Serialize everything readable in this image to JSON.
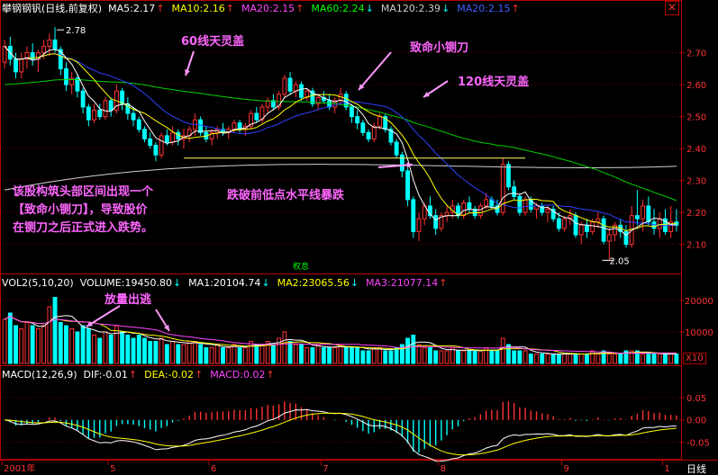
{
  "header": {
    "title": "攀钢钢钒(日线,前复权)",
    "ma": [
      {
        "label": "MA5:2.17",
        "color": "#ffffff",
        "arrow": "↑"
      },
      {
        "label": "MA10:2.16",
        "color": "#ffff00",
        "arrow": "↑"
      },
      {
        "label": "MA20:2.15",
        "color": "#ff44ff",
        "arrow": "↑"
      },
      {
        "label": "MA60:2.24",
        "color": "#00ff00",
        "arrow": "↓"
      },
      {
        "label": "MA120:2.39",
        "color": "#cccccc",
        "arrow": "↓"
      },
      {
        "label": "MA20:2.15",
        "color": "#4060ff",
        "arrow": "↑"
      }
    ],
    "close_box": "×"
  },
  "colors": {
    "up": "#ff3232",
    "down": "#00ffff",
    "ma5": "#ffffff",
    "ma10": "#ffff00",
    "ma20": "#3040ff",
    "ma60": "#00d000",
    "ma120": "#d0d0d0",
    "axis": "#b40000",
    "annotation": "#ff66ff",
    "arrow": "#ff99ff",
    "support": "#ffff60"
  },
  "annotations": {
    "a60": "60线天灵盖",
    "knife": "致命小铡刀",
    "a120": "120线天灵盖",
    "break": "跌破前低点水平线暴跌",
    "note_lines": [
      "该股构筑头部区间出现一个",
      "【致命小铡刀】，导致股价",
      "在铡刀之后正式进入跌势。"
    ],
    "volume": "放量出逃",
    "high": "2.78",
    "low": "2.05",
    "rights": "权息"
  },
  "volume_header": {
    "label": "VOL2(5,10,20)",
    "items": [
      {
        "label": "VOLUME:19450.80",
        "color": "#ffffff",
        "arrow": "↓"
      },
      {
        "label": "MA1:20104.74",
        "color": "#ffffff",
        "arrow": "↓"
      },
      {
        "label": "MA2:23065.56",
        "color": "#ffff00",
        "arrow": "↓"
      },
      {
        "label": "MA3:21077.14",
        "color": "#ff44ff",
        "arrow": "↑"
      }
    ],
    "unit": "X10"
  },
  "macd_header": {
    "label": "MACD(12,26,9)",
    "items": [
      {
        "label": "DIF:-0.01",
        "color": "#ffffff",
        "arrow": "↑"
      },
      {
        "label": "DEA:-0.02",
        "color": "#ffff00",
        "arrow": "↑"
      },
      {
        "label": "MACD:0.02",
        "color": "#ff44ff",
        "arrow": "↑"
      }
    ]
  },
  "bottom": {
    "first": "2001年",
    "period": "日线"
  },
  "chart_data": {
    "type": "candlestick",
    "price_axis": {
      "ticks": [
        "2.70",
        "2.60",
        "2.50",
        "2.40",
        "2.30",
        "2.20",
        "2.10"
      ],
      "range": [
        2.02,
        2.82
      ]
    },
    "volume_axis": {
      "ticks": [
        "20000",
        "10000"
      ],
      "range": [
        0,
        24000
      ]
    },
    "macd_axis": {
      "ticks": [
        "0.05",
        "0.00",
        "-0.05"
      ],
      "range": [
        -0.085,
        0.09
      ]
    },
    "x_labels": [
      {
        "label": "2001年",
        "day": 0
      },
      {
        "label": "5",
        "day": 19
      },
      {
        "label": "6",
        "day": 37
      },
      {
        "label": "7",
        "day": 57
      },
      {
        "label": "8",
        "day": 78
      },
      {
        "label": "9",
        "day": 100
      },
      {
        "label": "1",
        "day": 118
      }
    ],
    "support_line": {
      "value": 2.37,
      "from_day": 32,
      "to_day": 93
    },
    "candles": [
      [
        2.67,
        2.74,
        2.65,
        2.72
      ],
      [
        2.72,
        2.75,
        2.66,
        2.68
      ],
      [
        2.68,
        2.7,
        2.62,
        2.64
      ],
      [
        2.64,
        2.7,
        2.62,
        2.68
      ],
      [
        2.68,
        2.72,
        2.65,
        2.7
      ],
      [
        2.7,
        2.73,
        2.66,
        2.68
      ],
      [
        2.68,
        2.71,
        2.64,
        2.7
      ],
      [
        2.7,
        2.74,
        2.68,
        2.72
      ],
      [
        2.72,
        2.76,
        2.69,
        2.74
      ],
      [
        2.74,
        2.78,
        2.7,
        2.71
      ],
      [
        2.71,
        2.72,
        2.63,
        2.65
      ],
      [
        2.65,
        2.67,
        2.58,
        2.6
      ],
      [
        2.6,
        2.64,
        2.57,
        2.62
      ],
      [
        2.62,
        2.63,
        2.56,
        2.58
      ],
      [
        2.58,
        2.59,
        2.51,
        2.53
      ],
      [
        2.53,
        2.54,
        2.47,
        2.49
      ],
      [
        2.49,
        2.54,
        2.48,
        2.52
      ],
      [
        2.52,
        2.54,
        2.49,
        2.5
      ],
      [
        2.5,
        2.56,
        2.49,
        2.55
      ],
      [
        2.55,
        2.56,
        2.5,
        2.52
      ],
      [
        2.52,
        2.6,
        2.51,
        2.58
      ],
      [
        2.58,
        2.59,
        2.52,
        2.54
      ],
      [
        2.54,
        2.56,
        2.49,
        2.51
      ],
      [
        2.51,
        2.53,
        2.47,
        2.49
      ],
      [
        2.49,
        2.5,
        2.45,
        2.46
      ],
      [
        2.46,
        2.47,
        2.42,
        2.43
      ],
      [
        2.43,
        2.45,
        2.4,
        2.41
      ],
      [
        2.41,
        2.42,
        2.36,
        2.38
      ],
      [
        2.38,
        2.45,
        2.37,
        2.44
      ],
      [
        2.44,
        2.46,
        2.41,
        2.42
      ],
      [
        2.42,
        2.47,
        2.41,
        2.45
      ],
      [
        2.45,
        2.46,
        2.41,
        2.43
      ],
      [
        2.43,
        2.46,
        2.4,
        2.44
      ],
      [
        2.44,
        2.47,
        2.42,
        2.46
      ],
      [
        2.46,
        2.51,
        2.44,
        2.49
      ],
      [
        2.49,
        2.5,
        2.44,
        2.45
      ],
      [
        2.45,
        2.47,
        2.42,
        2.43
      ],
      [
        2.43,
        2.46,
        2.41,
        2.45
      ],
      [
        2.45,
        2.47,
        2.43,
        2.46
      ],
      [
        2.46,
        2.48,
        2.44,
        2.45
      ],
      [
        2.45,
        2.47,
        2.43,
        2.46
      ],
      [
        2.46,
        2.49,
        2.45,
        2.48
      ],
      [
        2.48,
        2.49,
        2.45,
        2.46
      ],
      [
        2.46,
        2.48,
        2.44,
        2.47
      ],
      [
        2.47,
        2.52,
        2.46,
        2.51
      ],
      [
        2.51,
        2.53,
        2.48,
        2.49
      ],
      [
        2.49,
        2.54,
        2.48,
        2.53
      ],
      [
        2.53,
        2.56,
        2.51,
        2.55
      ],
      [
        2.55,
        2.57,
        2.52,
        2.53
      ],
      [
        2.53,
        2.58,
        2.52,
        2.57
      ],
      [
        2.57,
        2.63,
        2.56,
        2.62
      ],
      [
        2.62,
        2.64,
        2.57,
        2.58
      ],
      [
        2.58,
        2.61,
        2.56,
        2.6
      ],
      [
        2.6,
        2.61,
        2.55,
        2.56
      ],
      [
        2.56,
        2.59,
        2.55,
        2.58
      ],
      [
        2.58,
        2.59,
        2.53,
        2.54
      ],
      [
        2.54,
        2.57,
        2.52,
        2.56
      ],
      [
        2.56,
        2.58,
        2.54,
        2.55
      ],
      [
        2.55,
        2.57,
        2.52,
        2.53
      ],
      [
        2.53,
        2.56,
        2.51,
        2.55
      ],
      [
        2.55,
        2.59,
        2.54,
        2.57
      ],
      [
        2.57,
        2.58,
        2.52,
        2.53
      ],
      [
        2.53,
        2.54,
        2.48,
        2.5
      ],
      [
        2.5,
        2.52,
        2.46,
        2.48
      ],
      [
        2.48,
        2.49,
        2.44,
        2.45
      ],
      [
        2.45,
        2.46,
        2.42,
        2.43
      ],
      [
        2.43,
        2.48,
        2.42,
        2.47
      ],
      [
        2.47,
        2.51,
        2.46,
        2.5
      ],
      [
        2.5,
        2.51,
        2.45,
        2.46
      ],
      [
        2.46,
        2.47,
        2.41,
        2.42
      ],
      [
        2.42,
        2.43,
        2.37,
        2.38
      ],
      [
        2.38,
        2.39,
        2.31,
        2.33
      ],
      [
        2.33,
        2.34,
        2.22,
        2.24
      ],
      [
        2.24,
        2.25,
        2.12,
        2.14
      ],
      [
        2.14,
        2.2,
        2.11,
        2.18
      ],
      [
        2.18,
        2.23,
        2.16,
        2.22
      ],
      [
        2.22,
        2.25,
        2.18,
        2.19
      ],
      [
        2.19,
        2.21,
        2.13,
        2.15
      ],
      [
        2.15,
        2.2,
        2.14,
        2.19
      ],
      [
        2.19,
        2.22,
        2.17,
        2.2
      ],
      [
        2.2,
        2.24,
        2.18,
        2.22
      ],
      [
        2.22,
        2.23,
        2.18,
        2.19
      ],
      [
        2.19,
        2.24,
        2.18,
        2.23
      ],
      [
        2.23,
        2.25,
        2.2,
        2.21
      ],
      [
        2.21,
        2.22,
        2.18,
        2.19
      ],
      [
        2.19,
        2.23,
        2.18,
        2.22
      ],
      [
        2.22,
        2.26,
        2.21,
        2.24
      ],
      [
        2.24,
        2.25,
        2.21,
        2.22
      ],
      [
        2.22,
        2.24,
        2.19,
        2.2
      ],
      [
        2.2,
        2.37,
        2.19,
        2.35
      ],
      [
        2.35,
        2.36,
        2.27,
        2.28
      ],
      [
        2.28,
        2.3,
        2.24,
        2.25
      ],
      [
        2.25,
        2.26,
        2.19,
        2.2
      ],
      [
        2.2,
        2.25,
        2.19,
        2.24
      ],
      [
        2.24,
        2.25,
        2.2,
        2.21
      ],
      [
        2.21,
        2.23,
        2.18,
        2.22
      ],
      [
        2.22,
        2.23,
        2.19,
        2.2
      ],
      [
        2.2,
        2.22,
        2.17,
        2.21
      ],
      [
        2.21,
        2.22,
        2.17,
        2.18
      ],
      [
        2.18,
        2.2,
        2.14,
        2.15
      ],
      [
        2.15,
        2.19,
        2.14,
        2.18
      ],
      [
        2.18,
        2.21,
        2.16,
        2.19
      ],
      [
        2.19,
        2.2,
        2.12,
        2.13
      ],
      [
        2.13,
        2.17,
        2.1,
        2.16
      ],
      [
        2.16,
        2.18,
        2.12,
        2.14
      ],
      [
        2.14,
        2.18,
        2.13,
        2.17
      ],
      [
        2.17,
        2.2,
        2.15,
        2.18
      ],
      [
        2.18,
        2.19,
        2.1,
        2.11
      ],
      [
        2.11,
        2.15,
        2.05,
        2.13
      ],
      [
        2.13,
        2.17,
        2.11,
        2.16
      ],
      [
        2.16,
        2.18,
        2.12,
        2.14
      ],
      [
        2.14,
        2.16,
        2.09,
        2.1
      ],
      [
        2.1,
        2.22,
        2.09,
        2.19
      ],
      [
        2.19,
        2.27,
        2.16,
        2.18
      ],
      [
        2.18,
        2.24,
        2.14,
        2.22
      ],
      [
        2.22,
        2.25,
        2.16,
        2.17
      ],
      [
        2.17,
        2.21,
        2.13,
        2.15
      ],
      [
        2.15,
        2.2,
        2.12,
        2.18
      ],
      [
        2.18,
        2.21,
        2.13,
        2.14
      ],
      [
        2.14,
        2.22,
        2.12,
        2.17
      ],
      [
        2.17,
        2.21,
        2.14,
        2.16
      ]
    ],
    "volume": [
      14,
      16,
      12,
      11,
      13,
      12,
      11,
      12,
      18,
      21,
      13,
      12,
      11,
      10,
      12,
      11,
      9,
      8,
      10,
      9,
      12,
      10,
      9,
      8,
      9,
      8,
      7,
      7,
      8,
      6,
      7,
      6,
      6,
      7,
      7,
      6,
      5,
      5,
      6,
      5,
      5,
      6,
      5,
      5,
      7,
      6,
      6,
      7,
      6,
      8,
      10,
      7,
      6,
      6,
      5,
      5,
      6,
      5,
      5,
      5,
      6,
      5,
      5,
      5,
      4,
      4,
      5,
      5,
      4,
      4,
      5,
      6,
      8,
      9,
      6,
      5,
      5,
      4,
      4,
      4,
      5,
      4,
      4,
      4,
      4,
      4,
      5,
      4,
      4,
      8,
      6,
      4,
      4,
      4,
      3,
      3,
      3,
      3,
      3,
      3,
      3,
      3,
      3,
      3,
      3,
      4,
      3,
      4,
      3,
      3,
      3,
      4,
      4,
      4,
      3,
      3,
      3,
      3,
      3,
      3,
      3
    ]
  }
}
